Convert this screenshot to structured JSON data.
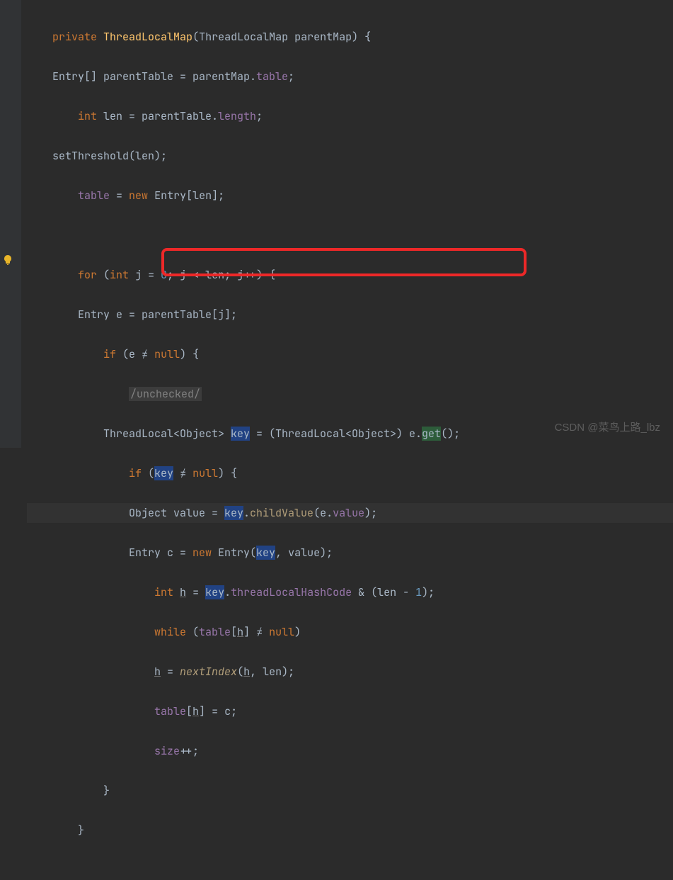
{
  "code": {
    "l1_private": "private",
    "l1_class": "ThreadLocalMap",
    "l1_rest": "(ThreadLocalMap parentMap) {",
    "l2": "    Entry[] parentTable = parentMap.",
    "l2_field": "table",
    "l2_end": ";",
    "l3_int": "int",
    "l3_mid": " len = parentTable.",
    "l3_field": "length",
    "l3_end": ";",
    "l4_a": "    setThreshold(len);",
    "l5_field": "table",
    "l5_b": " = ",
    "l5_new": "new",
    "l5_c": " Entry[len];",
    "l7_for": "for",
    "l7_a": " (",
    "l7_int": "int",
    "l7_b": " j = ",
    "l7_zero": "0",
    "l7_c": "; j < len; j++) {",
    "l8": "        Entry e = parentTable[j];",
    "l9_if": "if",
    "l9_a": " (e ",
    "l9_ne": "≠",
    "l9_b": " ",
    "l9_null": "null",
    "l9_c": ") {",
    "l10_comment": "/unchecked/",
    "l11_a": "            ThreadLocal<Object> ",
    "l11_key": "key",
    "l11_b": " = (ThreadLocal<Object>) e.",
    "l11_get": "get",
    "l11_c": "();",
    "l12_if": "if",
    "l12_a": " (",
    "l12_key": "key",
    "l12_b": " ",
    "l12_ne": "≠",
    "l12_c": " ",
    "l12_null": "null",
    "l12_d": ") {",
    "l13_a": "                Object value = ",
    "l13_key": "key",
    "l13_b": ".",
    "l13_method": "childValue",
    "l13_c": "(e.",
    "l13_field": "value",
    "l13_d": ");",
    "l14_a": "                Entry c = ",
    "l14_new": "new",
    "l14_b": " Entry(",
    "l14_key": "key",
    "l14_c": ", value);",
    "l15_int": "int",
    "l15_a": " ",
    "l15_h": "h",
    "l15_b": " = ",
    "l15_key": "key",
    "l15_c": ".",
    "l15_field": "threadLocalHashCode",
    "l15_d": " & (len - ",
    "l15_one": "1",
    "l15_e": ");",
    "l16_while": "while",
    "l16_a": " (",
    "l16_table": "table",
    "l16_b": "[",
    "l16_h": "h",
    "l16_c": "] ",
    "l16_ne": "≠",
    "l16_d": " ",
    "l16_null": "null",
    "l16_e": ")",
    "l17_a": "                    ",
    "l17_h": "h",
    "l17_b": " = ",
    "l17_method": "nextIndex",
    "l17_c": "(",
    "l17_h2": "h",
    "l17_d": ", len);",
    "l18_table": "table",
    "l18_a": "[",
    "l18_h": "h",
    "l18_b": "] = c;",
    "l19_size": "size",
    "l19_a": "++;",
    "l20": "            }",
    "l21": "        }"
  },
  "watermark": "CSDN @菜鸟上路_lbz"
}
